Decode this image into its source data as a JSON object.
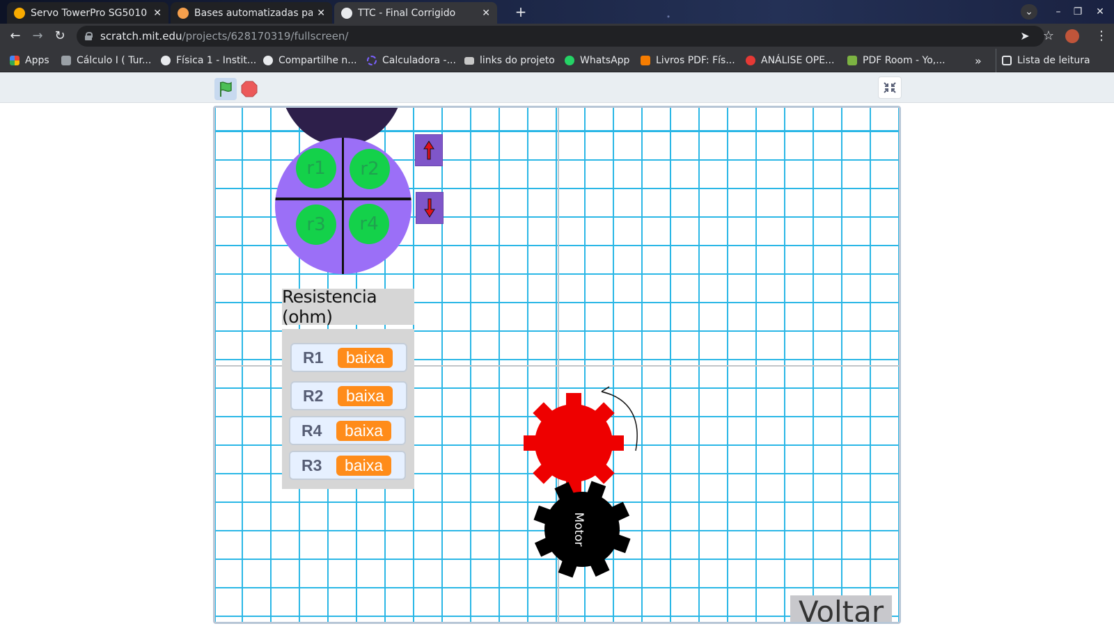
{
  "tabs": [
    {
      "label": "Servo TowerPro SG5010 - S",
      "fav_color": "#f9ab00"
    },
    {
      "label": "Bases automatizadas pai",
      "fav_color": "#f6a04d"
    },
    {
      "label": "TTC - Final Corrigido",
      "fav_color": "#e8eaed"
    }
  ],
  "address": {
    "host": "scratch.mit.edu",
    "path": "/projects/628170319/fullscreen/"
  },
  "bookmarks": [
    {
      "label": "Apps",
      "icon_color": "#ea4335"
    },
    {
      "label": "Cálculo I ( Tur...",
      "icon_color": "#9aa0a6"
    },
    {
      "label": "Física 1 - Instit...",
      "icon_color": "#e8eaed"
    },
    {
      "label": "Compartilhe n...",
      "icon_color": "#e8eaed"
    },
    {
      "label": "Calculadora -...",
      "icon_color": "#7b61ff"
    },
    {
      "label": "links do projeto",
      "icon_color": "#c7c7c7"
    },
    {
      "label": "WhatsApp",
      "icon_color": "#25d366"
    },
    {
      "label": "Livros PDF: Fís...",
      "icon_color": "#f57c00"
    },
    {
      "label": "ANÁLISE OPE...",
      "icon_color": "#e53935"
    },
    {
      "label": "PDF Room - Yo,...",
      "icon_color": "#7cb342"
    }
  ],
  "reading_list": "Lista de leitura",
  "more_bookmarks": "»",
  "stage": {
    "nodes": [
      "r1",
      "r2",
      "r3",
      "r4"
    ],
    "resistance_title": "Resistencia (ohm)",
    "monitors": [
      {
        "name": "R1",
        "value": "baixa"
      },
      {
        "name": "R2",
        "value": "baixa"
      },
      {
        "name": "R4",
        "value": "baixa"
      },
      {
        "name": "R3",
        "value": "baixa"
      }
    ],
    "motor_label": "Motor",
    "back_label": "Voltar"
  },
  "colors": {
    "gear_driven": "#ee0000",
    "gear_motor": "#000000",
    "monitor_value": "#ff8c1a",
    "node": "#14d14a",
    "board": "#9b6ff7"
  }
}
